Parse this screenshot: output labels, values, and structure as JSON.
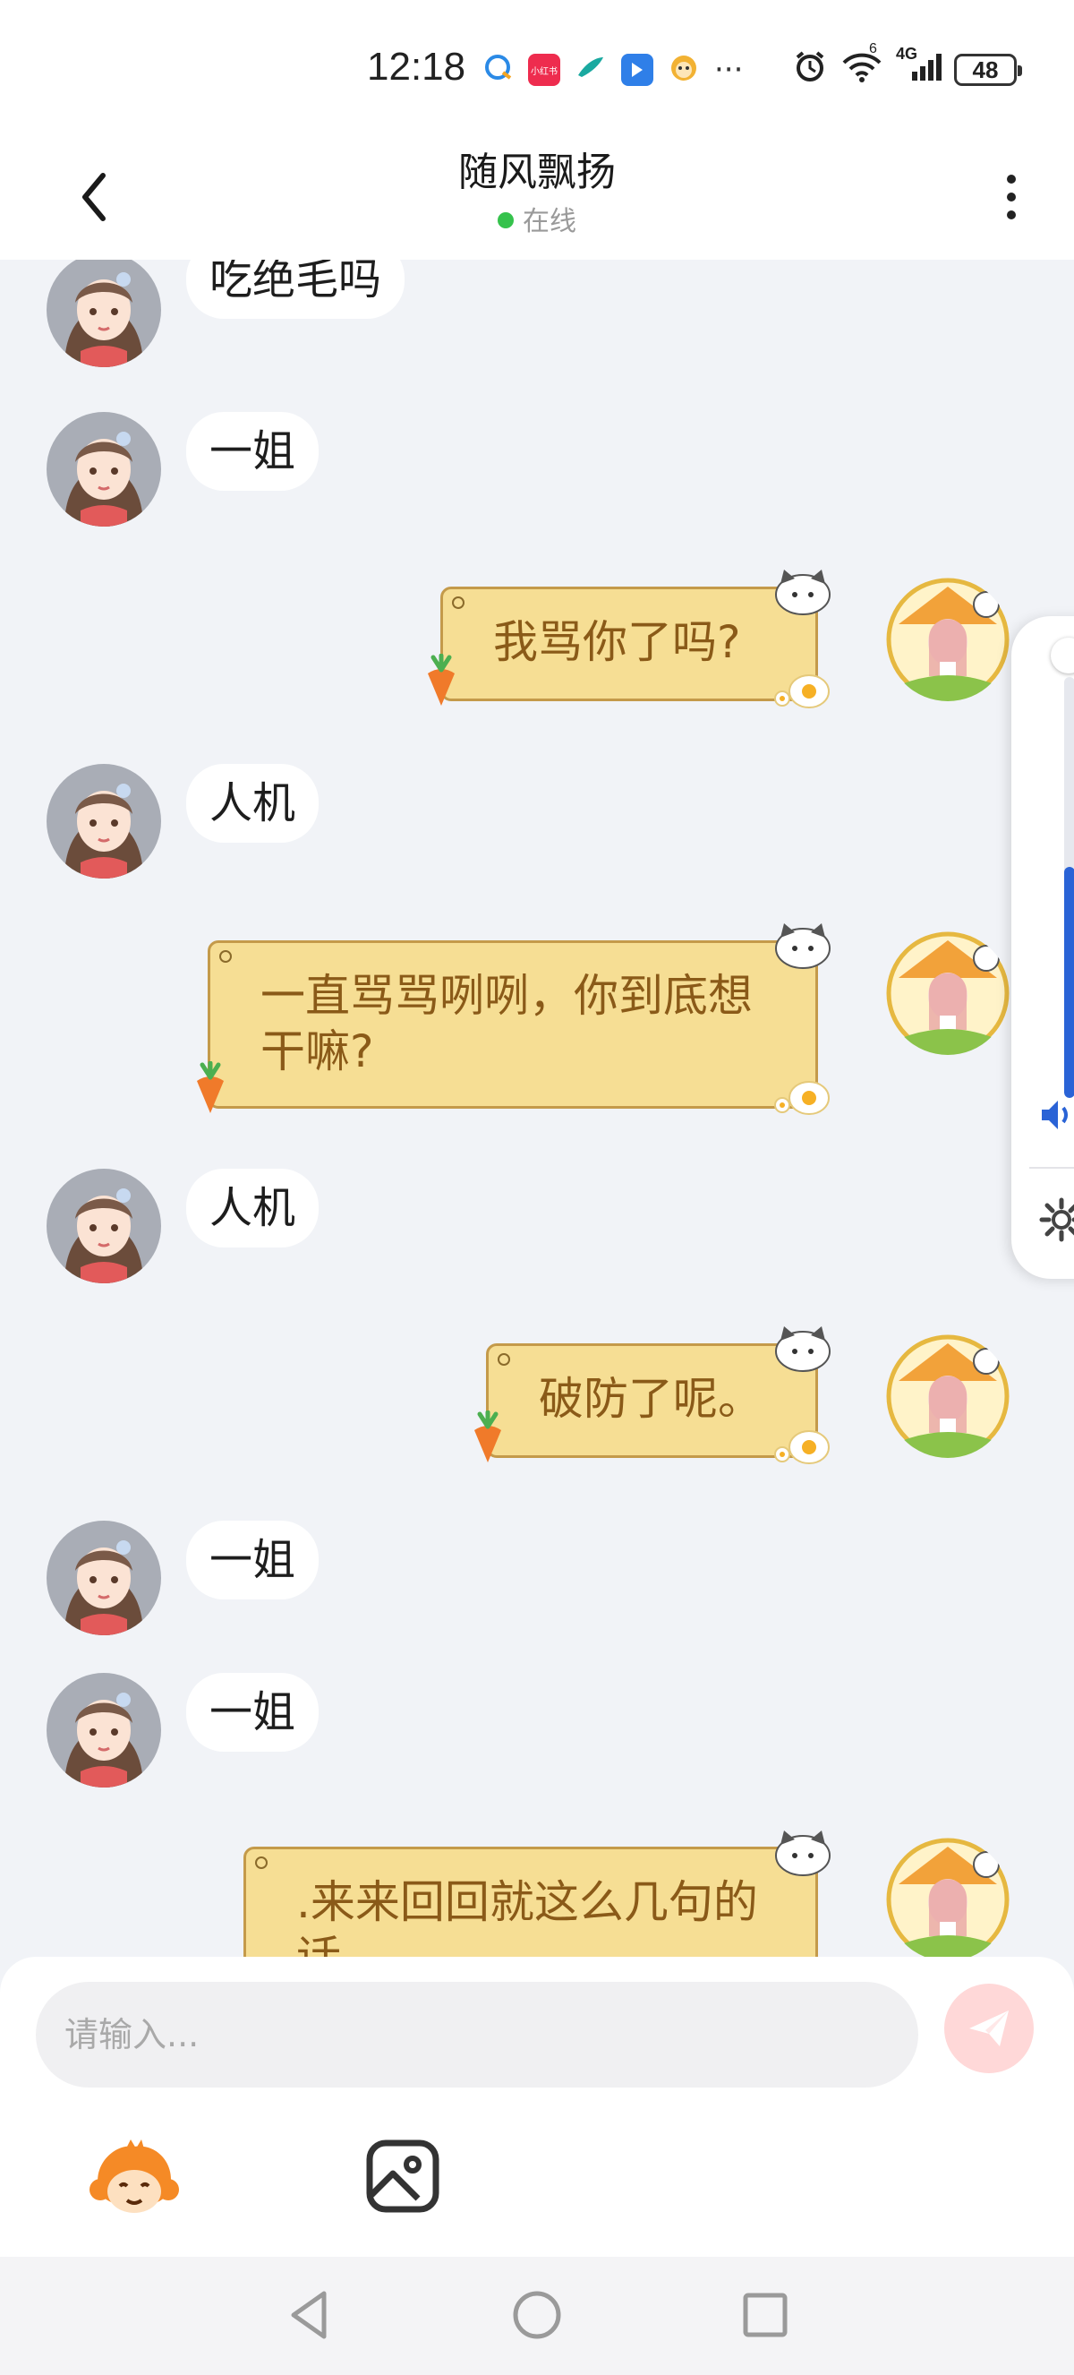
{
  "status_bar": {
    "time": "12:18",
    "app_icons": [
      "qq-browser-icon",
      "xiaohongshu-icon",
      "feather-app-icon",
      "blue-app-icon",
      "monkey-app-icon"
    ],
    "xiaohongshu_label": "小红书",
    "more": "···",
    "network": "4G",
    "wifi_badge": "6",
    "battery": "48"
  },
  "header": {
    "title": "随风飘扬",
    "status": "在线",
    "status_color": "#35c24c"
  },
  "messages": [
    {
      "side": "in",
      "text": "吃绝毛吗"
    },
    {
      "side": "in",
      "text": "一姐"
    },
    {
      "side": "out",
      "text": "我骂你了吗?"
    },
    {
      "side": "in",
      "text": "人机"
    },
    {
      "side": "out",
      "text": "一直骂骂咧咧，你到底想干嘛?"
    },
    {
      "side": "in",
      "text": "人机"
    },
    {
      "side": "out",
      "text": "破防了呢。"
    },
    {
      "side": "in",
      "text": "一姐"
    },
    {
      "side": "in",
      "text": "一姐"
    },
    {
      "side": "out",
      "text": ".来来回回就这么几句的话"
    }
  ],
  "input": {
    "placeholder": "请输入...",
    "value": ""
  },
  "toolbar": {
    "emoji_icon": "monkey-face-icon",
    "image_icon": "image-icon",
    "send_icon": "paper-plane-icon",
    "send_color": "#ffd8d8"
  },
  "volume": {
    "level": 0.55,
    "accent": "#2a63d6"
  },
  "colors": {
    "outgoing_bubble": "#f6de94",
    "outgoing_text": "#8a5a18",
    "background": "#f1f3f7"
  }
}
